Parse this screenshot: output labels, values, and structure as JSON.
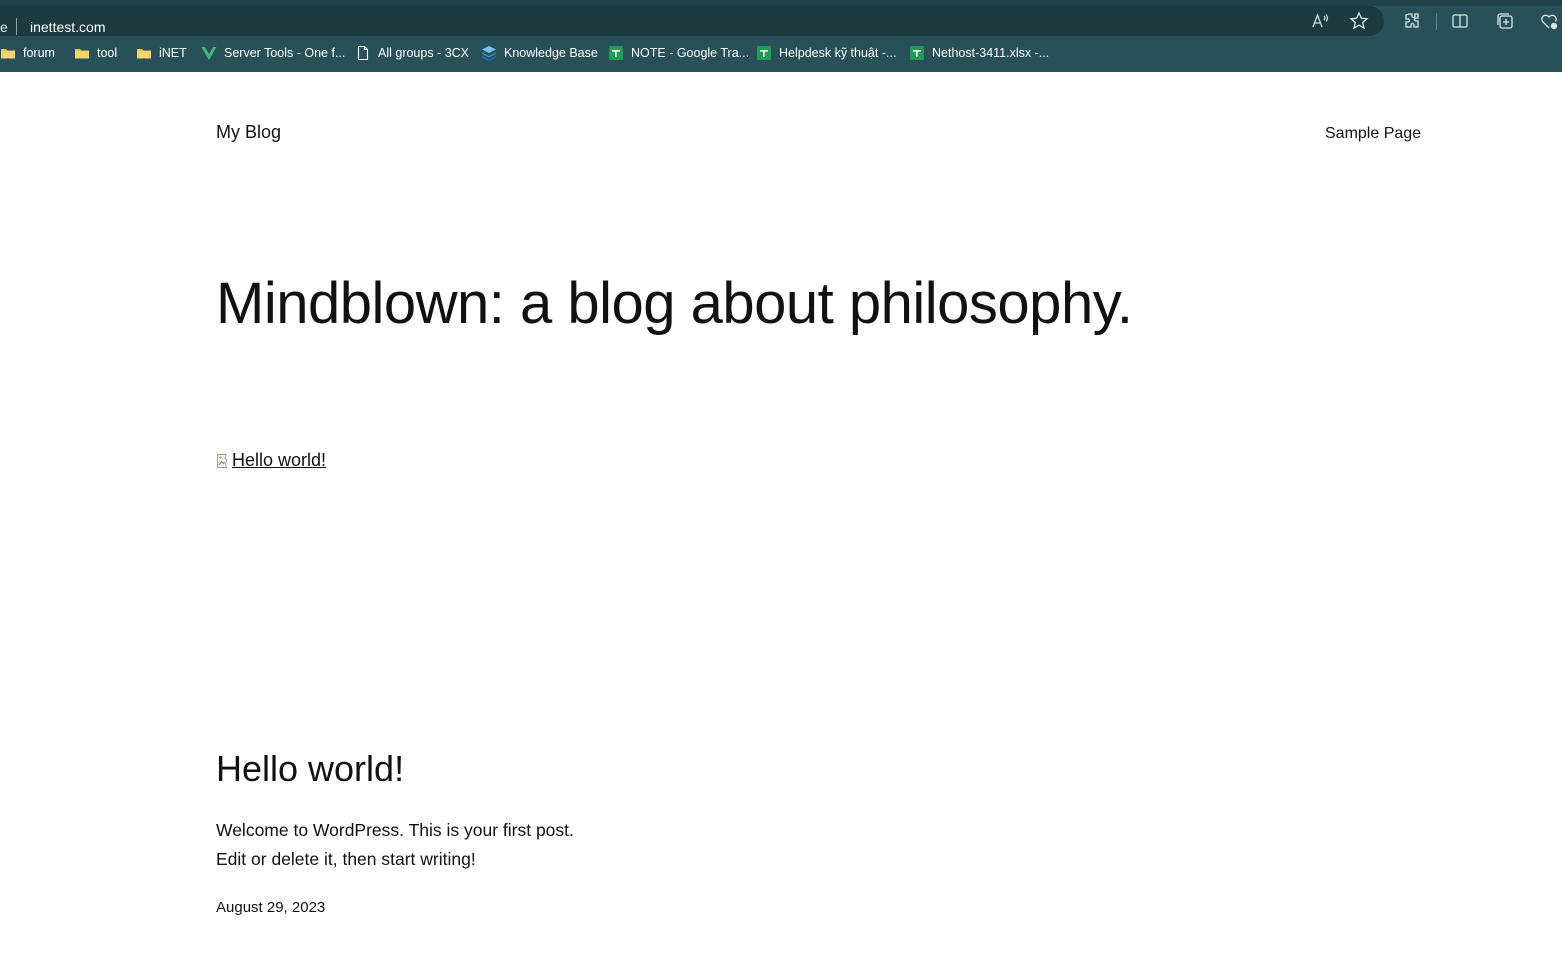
{
  "browser": {
    "address_cut_char": "e",
    "url": "inettest.com",
    "bookmarks": [
      {
        "label": "forum",
        "icon": "folder-icon"
      },
      {
        "label": "tool",
        "icon": "folder-icon"
      },
      {
        "label": "iNET",
        "icon": "folder-icon"
      },
      {
        "label": "Server Tools - One f...",
        "icon": "v-logo-icon"
      },
      {
        "label": "All groups - 3CX",
        "icon": "page-icon"
      },
      {
        "label": "Knowledge Base",
        "icon": "stack-icon"
      },
      {
        "label": "NOTE - Google Tra...",
        "icon": "sheets-icon"
      },
      {
        "label": "Helpdesk kỹ thuật -...",
        "icon": "sheets-icon"
      },
      {
        "label": "Nethost-3411.xlsx -...",
        "icon": "sheets-icon"
      }
    ],
    "colors": {
      "chrome": "#285058",
      "address_bar": "#1d3a40",
      "folder": "#f2c14e",
      "sheets": "#1e9e55",
      "vue_green": "#41b883",
      "stack_blue": "#3b8fd8"
    }
  },
  "site": {
    "title": "My Blog",
    "nav": [
      "Sample Page"
    ],
    "hero": "Mindblown: a blog about philosophy."
  },
  "post": {
    "image_alt": "Hello world!",
    "title": "Hello world!",
    "excerpt_line1": "Welcome to WordPress. This is your first post.",
    "excerpt_line2": "Edit or delete it, then start writing!",
    "date": "August 29, 2023"
  }
}
